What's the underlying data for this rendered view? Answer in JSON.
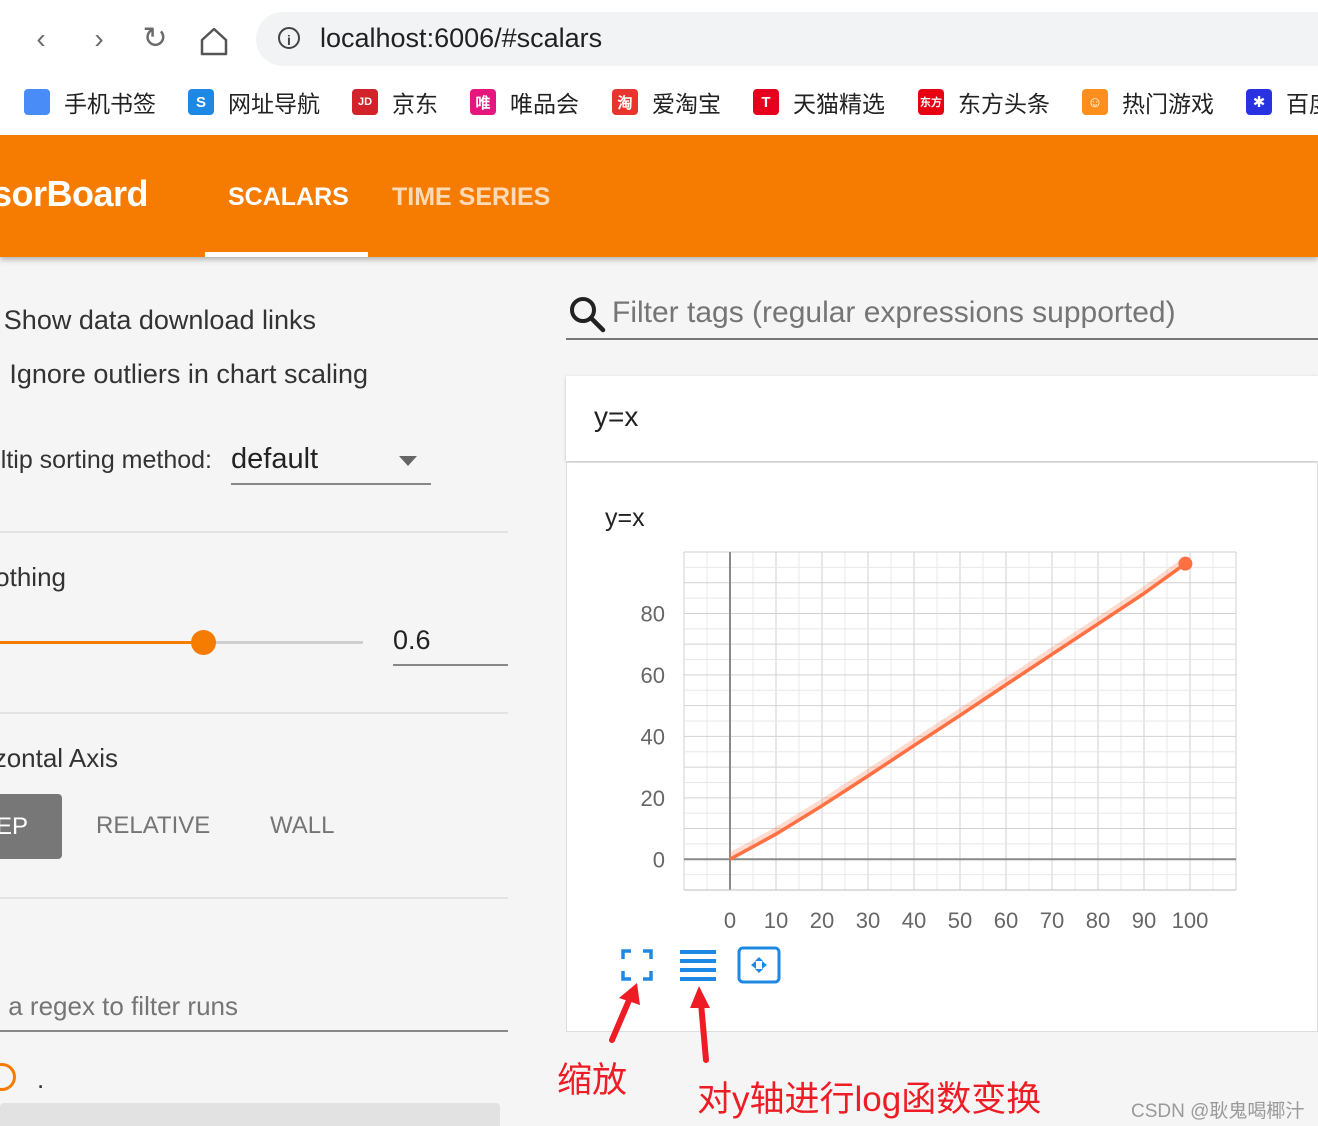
{
  "browser": {
    "address": "localhost:6006/#scalars",
    "bookmarks": [
      {
        "label": "手机书签",
        "icon": "phone-bookmark-icon",
        "color": "#4a8cf7",
        "glyph": ""
      },
      {
        "label": "网址导航",
        "icon": "nav-icon",
        "color": "#1e88e5",
        "glyph": "S"
      },
      {
        "label": "京东",
        "icon": "jd-icon",
        "color": "#d2232a",
        "glyph": "JD"
      },
      {
        "label": "唯品会",
        "icon": "vip-icon",
        "color": "#e5177e",
        "glyph": "唯"
      },
      {
        "label": "爱淘宝",
        "icon": "taobao-icon",
        "color": "#e8352f",
        "glyph": "淘"
      },
      {
        "label": "天猫精选",
        "icon": "tmall-icon",
        "color": "#e6001e",
        "glyph": "T"
      },
      {
        "label": "东方头条",
        "icon": "dongfang-icon",
        "color": "#e60012",
        "glyph": "东方"
      },
      {
        "label": "热门游戏",
        "icon": "game-icon",
        "color": "#ff8f1c",
        "glyph": "☺"
      },
      {
        "label": "百度",
        "icon": "baidu-paw-icon",
        "color": "#2932e1",
        "glyph": "✱"
      }
    ]
  },
  "header": {
    "brand": "TensorBoard",
    "tabs": [
      "SCALARS",
      "TIME SERIES"
    ],
    "active_tab": "SCALARS",
    "accent": "#f57c00"
  },
  "sidebar": {
    "show_download_links": "Show data download links",
    "ignore_outliers": "Ignore outliers in chart scaling",
    "sorting_label": "Tooltip sorting method:",
    "sorting_value": "default",
    "smoothing_label": "Smoothing",
    "smoothing_value": "0.6",
    "smoothing_fraction": 0.6,
    "horizontal_axis_label": "Horizontal Axis",
    "axis_options": [
      "STEP",
      "RELATIVE",
      "WALL"
    ],
    "axis_selected": "STEP",
    "run_filter_placeholder": "Write a regex to filter runs",
    "run_name": "."
  },
  "main": {
    "filter_placeholder": "Filter tags (regular expressions supported)",
    "card_title": "y=x",
    "tools": [
      "zoom-icon",
      "log-scale-icon",
      "fit-domain-icon"
    ]
  },
  "chart_data": {
    "type": "line",
    "title": "y=x",
    "xlim": [
      -10,
      110
    ],
    "ylim": [
      -10,
      100
    ],
    "xticks": [
      0,
      10,
      20,
      30,
      40,
      50,
      60,
      70,
      80,
      90,
      100
    ],
    "yticks": [
      0,
      20,
      40,
      60,
      80
    ],
    "grid": true,
    "series": [
      {
        "color": "#ff7043",
        "x": [
          0,
          10,
          20,
          30,
          40,
          50,
          60,
          70,
          80,
          90,
          99
        ],
        "y": [
          0,
          8.2,
          17.4,
          27.1,
          37.0,
          46.8,
          56.8,
          66.7,
          76.6,
          86.5,
          96.2
        ]
      }
    ]
  },
  "annotations": {
    "zoom_label": "缩放",
    "log_label": "对y轴进行log函数变换",
    "arrow_color": "#ee1c24"
  },
  "watermark": "CSDN @耿鬼喝椰汁"
}
